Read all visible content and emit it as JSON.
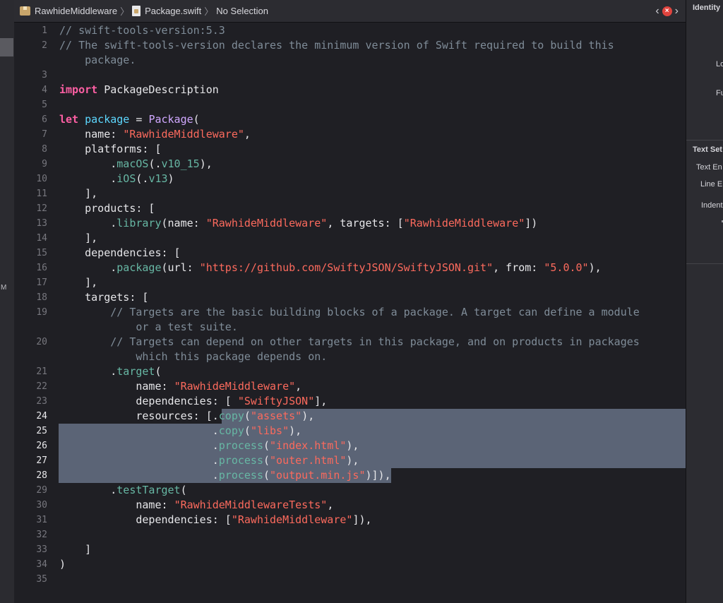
{
  "breadcrumb": {
    "project": "RawhideMiddleware",
    "file": "Package.swift",
    "selection": "No Selection"
  },
  "icons": {
    "project": "package-icon",
    "file": "swift-file-icon",
    "back": "chevron-left-icon",
    "forward": "chevron-right-icon",
    "issue": "error-badge-icon"
  },
  "colors": {
    "comment": "#7f8c98",
    "keyword": "#fc5fa3",
    "declaration": "#5dd8ff",
    "string": "#fc6a5d",
    "member": "#67b7a4",
    "number": "#d0bf69",
    "selection": "#5b6476"
  },
  "code": {
    "lines": [
      {
        "n": "1",
        "tokens": [
          [
            "// swift-tools-version:5.3",
            "comment"
          ]
        ]
      },
      {
        "n": "2",
        "tokens": [
          [
            "// The swift-tools-version declares the minimum version of Swift required to build this",
            "comment"
          ]
        ]
      },
      {
        "n": "",
        "tokens": [
          [
            "    package.",
            "comment"
          ]
        ]
      },
      {
        "n": "3",
        "tokens": []
      },
      {
        "n": "4",
        "tokens": [
          [
            "import",
            "kw"
          ],
          [
            " PackageDescription",
            ""
          ]
        ]
      },
      {
        "n": "5",
        "tokens": []
      },
      {
        "n": "6",
        "tokens": [
          [
            "let",
            "kw"
          ],
          [
            " ",
            ""
          ],
          [
            "package",
            "decl"
          ],
          [
            " = ",
            ""
          ],
          [
            "Package",
            "type"
          ],
          [
            "(",
            ""
          ]
        ]
      },
      {
        "n": "7",
        "tokens": [
          [
            "    name: ",
            ""
          ],
          [
            "\"RawhideMiddleware\"",
            "str"
          ],
          [
            ",",
            ""
          ]
        ]
      },
      {
        "n": "8",
        "tokens": [
          [
            "    platforms: [",
            ""
          ]
        ]
      },
      {
        "n": "9",
        "tokens": [
          [
            "        .",
            ""
          ],
          [
            "macOS",
            "member"
          ],
          [
            "(.",
            ""
          ],
          [
            "v10_15",
            "member"
          ],
          [
            "),",
            ""
          ]
        ]
      },
      {
        "n": "10",
        "tokens": [
          [
            "        .",
            ""
          ],
          [
            "iOS",
            "member"
          ],
          [
            "(.",
            ""
          ],
          [
            "v13",
            "member"
          ],
          [
            ")",
            ""
          ]
        ]
      },
      {
        "n": "11",
        "tokens": [
          [
            "    ],",
            ""
          ]
        ]
      },
      {
        "n": "12",
        "tokens": [
          [
            "    products: [",
            ""
          ]
        ]
      },
      {
        "n": "13",
        "tokens": [
          [
            "        .",
            ""
          ],
          [
            "library",
            "member"
          ],
          [
            "(name: ",
            ""
          ],
          [
            "\"RawhideMiddleware\"",
            "str"
          ],
          [
            ", targets: [",
            ""
          ],
          [
            "\"RawhideMiddleware\"",
            "str"
          ],
          [
            "])",
            ""
          ]
        ]
      },
      {
        "n": "14",
        "tokens": [
          [
            "    ],",
            ""
          ]
        ]
      },
      {
        "n": "15",
        "tokens": [
          [
            "    dependencies: [",
            ""
          ]
        ]
      },
      {
        "n": "16",
        "tokens": [
          [
            "        .",
            ""
          ],
          [
            "package",
            "member"
          ],
          [
            "(url: ",
            ""
          ],
          [
            "\"https://github.com/SwiftyJSON/SwiftyJSON.git\"",
            "str"
          ],
          [
            ", from: ",
            ""
          ],
          [
            "\"5.0.0\"",
            "str"
          ],
          [
            "),",
            ""
          ]
        ]
      },
      {
        "n": "17",
        "tokens": [
          [
            "    ],",
            ""
          ]
        ]
      },
      {
        "n": "18",
        "tokens": [
          [
            "    targets: [",
            ""
          ]
        ]
      },
      {
        "n": "19",
        "tokens": [
          [
            "        // Targets are the basic building blocks of a package. A target can define a module",
            "comment"
          ]
        ]
      },
      {
        "n": "",
        "tokens": [
          [
            "            or a test suite.",
            "comment"
          ]
        ]
      },
      {
        "n": "20",
        "tokens": [
          [
            "        // Targets can depend on other targets in this package, and on products in packages",
            "comment"
          ]
        ]
      },
      {
        "n": "",
        "tokens": [
          [
            "            which this package depends on.",
            "comment"
          ]
        ]
      },
      {
        "n": "21",
        "tokens": [
          [
            "        .",
            ""
          ],
          [
            "target",
            "member"
          ],
          [
            "(",
            ""
          ]
        ]
      },
      {
        "n": "22",
        "tokens": [
          [
            "            name: ",
            ""
          ],
          [
            "\"RawhideMiddleware\"",
            "str"
          ],
          [
            ",",
            ""
          ]
        ]
      },
      {
        "n": "23",
        "tokens": [
          [
            "            dependencies: [ ",
            ""
          ],
          [
            "\"SwiftyJSON\"",
            "str"
          ],
          [
            "],",
            ""
          ]
        ]
      },
      {
        "n": "24",
        "hl": "partial",
        "tokens": [
          [
            "            resources: [.",
            ""
          ],
          [
            "copy",
            "member"
          ],
          [
            "(",
            ""
          ],
          [
            "\"assets\"",
            "str"
          ],
          [
            "),",
            ""
          ]
        ]
      },
      {
        "n": "25",
        "hl": "full",
        "tokens": [
          [
            "                        .",
            ""
          ],
          [
            "copy",
            "member"
          ],
          [
            "(",
            ""
          ],
          [
            "\"libs\"",
            "str"
          ],
          [
            "),",
            ""
          ]
        ]
      },
      {
        "n": "26",
        "hl": "full",
        "tokens": [
          [
            "                        .",
            ""
          ],
          [
            "process",
            "member"
          ],
          [
            "(",
            ""
          ],
          [
            "\"index.html\"",
            "str"
          ],
          [
            "),",
            ""
          ]
        ]
      },
      {
        "n": "27",
        "hl": "full",
        "tokens": [
          [
            "                        .",
            ""
          ],
          [
            "process",
            "member"
          ],
          [
            "(",
            ""
          ],
          [
            "\"outer.html\"",
            "str"
          ],
          [
            "),",
            ""
          ]
        ]
      },
      {
        "n": "28",
        "hl": "tail",
        "tokens": [
          [
            "                        .",
            ""
          ],
          [
            "process",
            "member"
          ],
          [
            "(",
            ""
          ],
          [
            "\"output.min.js\"",
            "str"
          ],
          [
            ")]),",
            ""
          ]
        ]
      },
      {
        "n": "29",
        "tokens": [
          [
            "        .",
            ""
          ],
          [
            "testTarget",
            "member"
          ],
          [
            "(",
            ""
          ]
        ]
      },
      {
        "n": "30",
        "tokens": [
          [
            "            name: ",
            ""
          ],
          [
            "\"RawhideMiddlewareTests\"",
            "str"
          ],
          [
            ",",
            ""
          ]
        ]
      },
      {
        "n": "31",
        "tokens": [
          [
            "            dependencies: [",
            ""
          ],
          [
            "\"RawhideMiddleware\"",
            "str"
          ],
          [
            "]),",
            ""
          ]
        ]
      },
      {
        "n": "32",
        "tokens": []
      },
      {
        "n": "33",
        "tokens": [
          [
            "    ]",
            ""
          ]
        ]
      },
      {
        "n": "34",
        "tokens": [
          [
            ")",
            ""
          ]
        ]
      },
      {
        "n": "35",
        "tokens": []
      }
    ]
  },
  "inspector": {
    "identity_title": "Identity",
    "label_lo": "Lo",
    "label_fu": "Fu",
    "text_settings_title": "Text Set",
    "text_encoding_label": "Text En",
    "line_endings_label": "Line E",
    "indent_label": "Indent"
  }
}
